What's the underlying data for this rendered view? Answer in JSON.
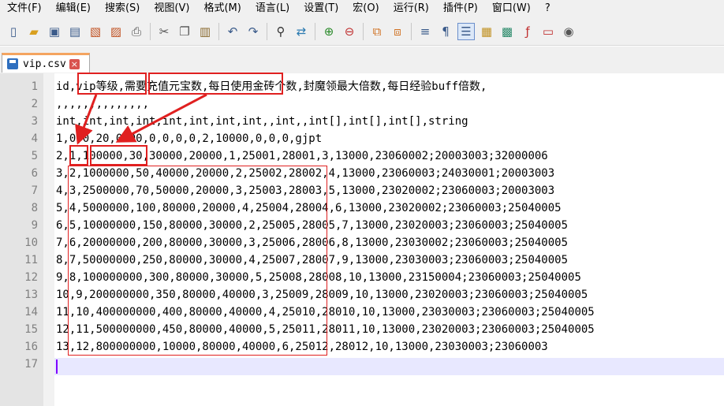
{
  "menu": [
    "文件(F)",
    "编辑(E)",
    "搜索(S)",
    "视图(V)",
    "格式(M)",
    "语言(L)",
    "设置(T)",
    "宏(O)",
    "运行(R)",
    "插件(P)",
    "窗口(W)",
    "?"
  ],
  "toolbar_icons": [
    "new-file-icon",
    "open-file-icon",
    "save-icon",
    "save-all-icon",
    "close-icon",
    "close-all-icon",
    "print-icon",
    "cut-icon",
    "copy-icon",
    "paste-icon",
    "undo-icon",
    "redo-icon",
    "find-icon",
    "replace-icon",
    "zoom-in-icon",
    "zoom-out-icon",
    "sync-v-icon",
    "sync-h-icon",
    "word-wrap-icon",
    "show-all-chars-icon",
    "indent-guide-icon",
    "udl-icon",
    "doc-map-icon",
    "function-list-icon",
    "folder-workspace-icon",
    "monitor-icon"
  ],
  "tab": {
    "filename": "vip.csv",
    "close_glyph": "×"
  },
  "lines": [
    {
      "n": "1",
      "text": "id,vip等级,需要充值元宝数,每日使用金砖个数,封魔领最大倍数,每日经验buff倍数,"
    },
    {
      "n": "2",
      "text": ",,,,,,,,,,,,,,"
    },
    {
      "n": "3",
      "text": "int,int,int,int,int,int,int,int,,int,,int[],int[],int[],string"
    },
    {
      "n": "4",
      "text": "1,0,0,20,0000,0,0,0,0,2,10000,0,0,0,gjpt"
    },
    {
      "n": "5",
      "text": "2,1,100000,30,30000,20000,1,25001,28001,3,13000,23060002;20003003;32000006"
    },
    {
      "n": "6",
      "text": "3,2,1000000,50,40000,20000,2,25002,28002,4,13000,23060003;24030001;20003003"
    },
    {
      "n": "7",
      "text": "4,3,2500000,70,50000,20000,3,25003,28003,5,13000,23020002;23060003;20003003"
    },
    {
      "n": "8",
      "text": "5,4,5000000,100,80000,20000,4,25004,28004,6,13000,23020002;23060003;25040005"
    },
    {
      "n": "9",
      "text": "6,5,10000000,150,80000,30000,2,25005,28005,7,13000,23020003;23060003;25040005"
    },
    {
      "n": "10",
      "text": "7,6,20000000,200,80000,30000,3,25006,28006,8,13000,23030002;23060003;25040005"
    },
    {
      "n": "11",
      "text": "8,7,50000000,250,80000,30000,4,25007,28007,9,13000,23030003;23060003;25040005"
    },
    {
      "n": "12",
      "text": "9,8,100000000,300,80000,30000,5,25008,28008,10,13000,23150004;23060003;25040005"
    },
    {
      "n": "13",
      "text": "10,9,200000000,350,80000,40000,3,25009,28009,10,13000,23020003;23060003;25040005"
    },
    {
      "n": "14",
      "text": "11,10,400000000,400,80000,40000,4,25010,28010,10,13000,23030003;23060003;25040005"
    },
    {
      "n": "15",
      "text": "12,11,500000000,450,80000,40000,5,25011,28011,10,13000,23020003;23060003;25040005"
    },
    {
      "n": "16",
      "text": "13,12,800000000,10000,80000,40000,6,25012,28012,10,13000,23030003;23060003"
    },
    {
      "n": "17",
      "text": ""
    }
  ],
  "colors": {
    "annotation": "#e02020",
    "line_numbers_bg": "#e4e4e4",
    "current_line": "#e8e8ff",
    "caret": "#8000ff"
  }
}
